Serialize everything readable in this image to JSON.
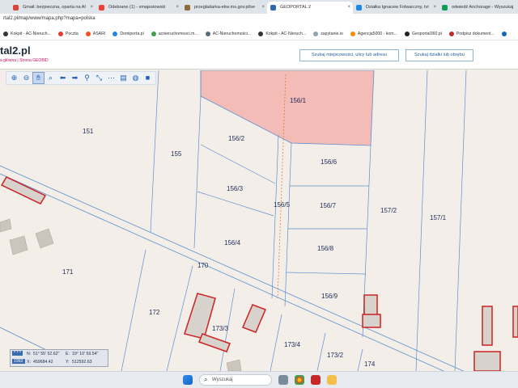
{
  "browser": {
    "tabs": [
      {
        "label": "Gmail: bezpieczna, oparta na AI",
        "color": "#db4437"
      },
      {
        "label": "Odebrane (1) - xmajestowski",
        "color": "#ea4335"
      },
      {
        "label": "przegladarka-ekw.ms.gov.pl/se",
        "color": "#8a6d3b"
      },
      {
        "label": "GEOPORTAL 2",
        "color": "#2b6cb0"
      },
      {
        "label": "Działka Ignacew Folwarczny, tvi",
        "color": "#1e88e5"
      },
      {
        "label": "odwiedź Anchorage - Wyszukaj",
        "color": "#0f9d58"
      }
    ],
    "address": "rtal2.pl/map/www/mapa.php?mapa=polska",
    "bookmarks": [
      {
        "label": "Kokpit - AC-Nieruch...",
        "color": "#333333"
      },
      {
        "label": "Poczta",
        "color": "#e53935"
      },
      {
        "label": "ASARI",
        "color": "#f4511e"
      },
      {
        "label": "Domiporta.pl",
        "color": "#1e88e5"
      },
      {
        "label": "acnieruchomosci.m...",
        "color": "#43a047"
      },
      {
        "label": "AC-Nieruchomości...",
        "color": "#546e7a"
      },
      {
        "label": "Kokpit - AC-Nieruch...",
        "color": "#333333"
      },
      {
        "label": "zapytanie.io",
        "color": "#90a4ae"
      },
      {
        "label": "Agencja5000 - kom...",
        "color": "#fb8c00"
      },
      {
        "label": "Geoportal360.pl",
        "color": "#212121"
      },
      {
        "label": "Podpisz dokument...",
        "color": "#c62828"
      },
      {
        "label": "",
        "color": "#1565c0"
      }
    ]
  },
  "site": {
    "logo": "tal2.pl",
    "crumbs": "a główna  |  Strona GEOBID",
    "search_location": "Szukaj miejscowości, ulicy lub adresu",
    "search_parcel": "Szukaj działki lub obrębu"
  },
  "map": {
    "parcels": [
      {
        "id": "p156_1",
        "label": "156/1"
      },
      {
        "id": "p151",
        "label": "151"
      },
      {
        "id": "p155",
        "label": "155"
      },
      {
        "id": "p156_2",
        "label": "156/2"
      },
      {
        "id": "p156_6",
        "label": "156/6"
      },
      {
        "id": "p156_3",
        "label": "156/3"
      },
      {
        "id": "p156_5",
        "label": "156/5"
      },
      {
        "id": "p156_7",
        "label": "156/7"
      },
      {
        "id": "p157_2",
        "label": "157/2"
      },
      {
        "id": "p157_1",
        "label": "157/1"
      },
      {
        "id": "p156_4",
        "label": "156/4"
      },
      {
        "id": "p156_8",
        "label": "156/8"
      },
      {
        "id": "p171",
        "label": "171"
      },
      {
        "id": "p170",
        "label": "170"
      },
      {
        "id": "p156_9",
        "label": "156/9"
      },
      {
        "id": "p172",
        "label": "172"
      },
      {
        "id": "p173_3",
        "label": "173/3"
      },
      {
        "id": "p173_4",
        "label": "173/4"
      },
      {
        "id": "p173_2",
        "label": "173/2"
      },
      {
        "id": "p174",
        "label": "174"
      }
    ],
    "tools": [
      {
        "name": "zoom-in-icon",
        "glyph": "🔍︎"
      },
      {
        "name": "zoom-out-icon",
        "glyph": "🔍︎"
      },
      {
        "name": "pan-hand-icon",
        "glyph": "✋︎"
      },
      {
        "name": "zoom-window-icon",
        "glyph": "🔍︎"
      },
      {
        "name": "back-arrow-icon",
        "glyph": "⬅︎"
      },
      {
        "name": "forward-arrow-icon",
        "glyph": "➡︎"
      },
      {
        "name": "measure-icon",
        "glyph": "🔗︎"
      },
      {
        "name": "distance-icon",
        "glyph": "⤡"
      },
      {
        "name": "area-icon",
        "glyph": "⋯"
      },
      {
        "name": "print-icon",
        "glyph": "🖶︎"
      },
      {
        "name": "globe-icon",
        "glyph": "🌐︎"
      },
      {
        "name": "video-icon",
        "glyph": "▶︎"
      }
    ],
    "coords": {
      "n_label": "N:",
      "n_value": "51° 55' 52.62\"",
      "e_label": "E:",
      "e_value": "19° 10' 59.54\"",
      "x_label": "X:",
      "x_value": "459684.42",
      "y_label": "Y:",
      "y_value": "512592.63",
      "system": "1992",
      "scale_marker": "* * *"
    }
  },
  "taskbar": {
    "search_placeholder": "Wyszukaj"
  },
  "colors": {
    "selected_parcel_fill": "#f4bcb6",
    "boundary_blue": "#5b8fd1",
    "building_red": "#cc2222",
    "accent_blue": "#1f5f9a"
  }
}
